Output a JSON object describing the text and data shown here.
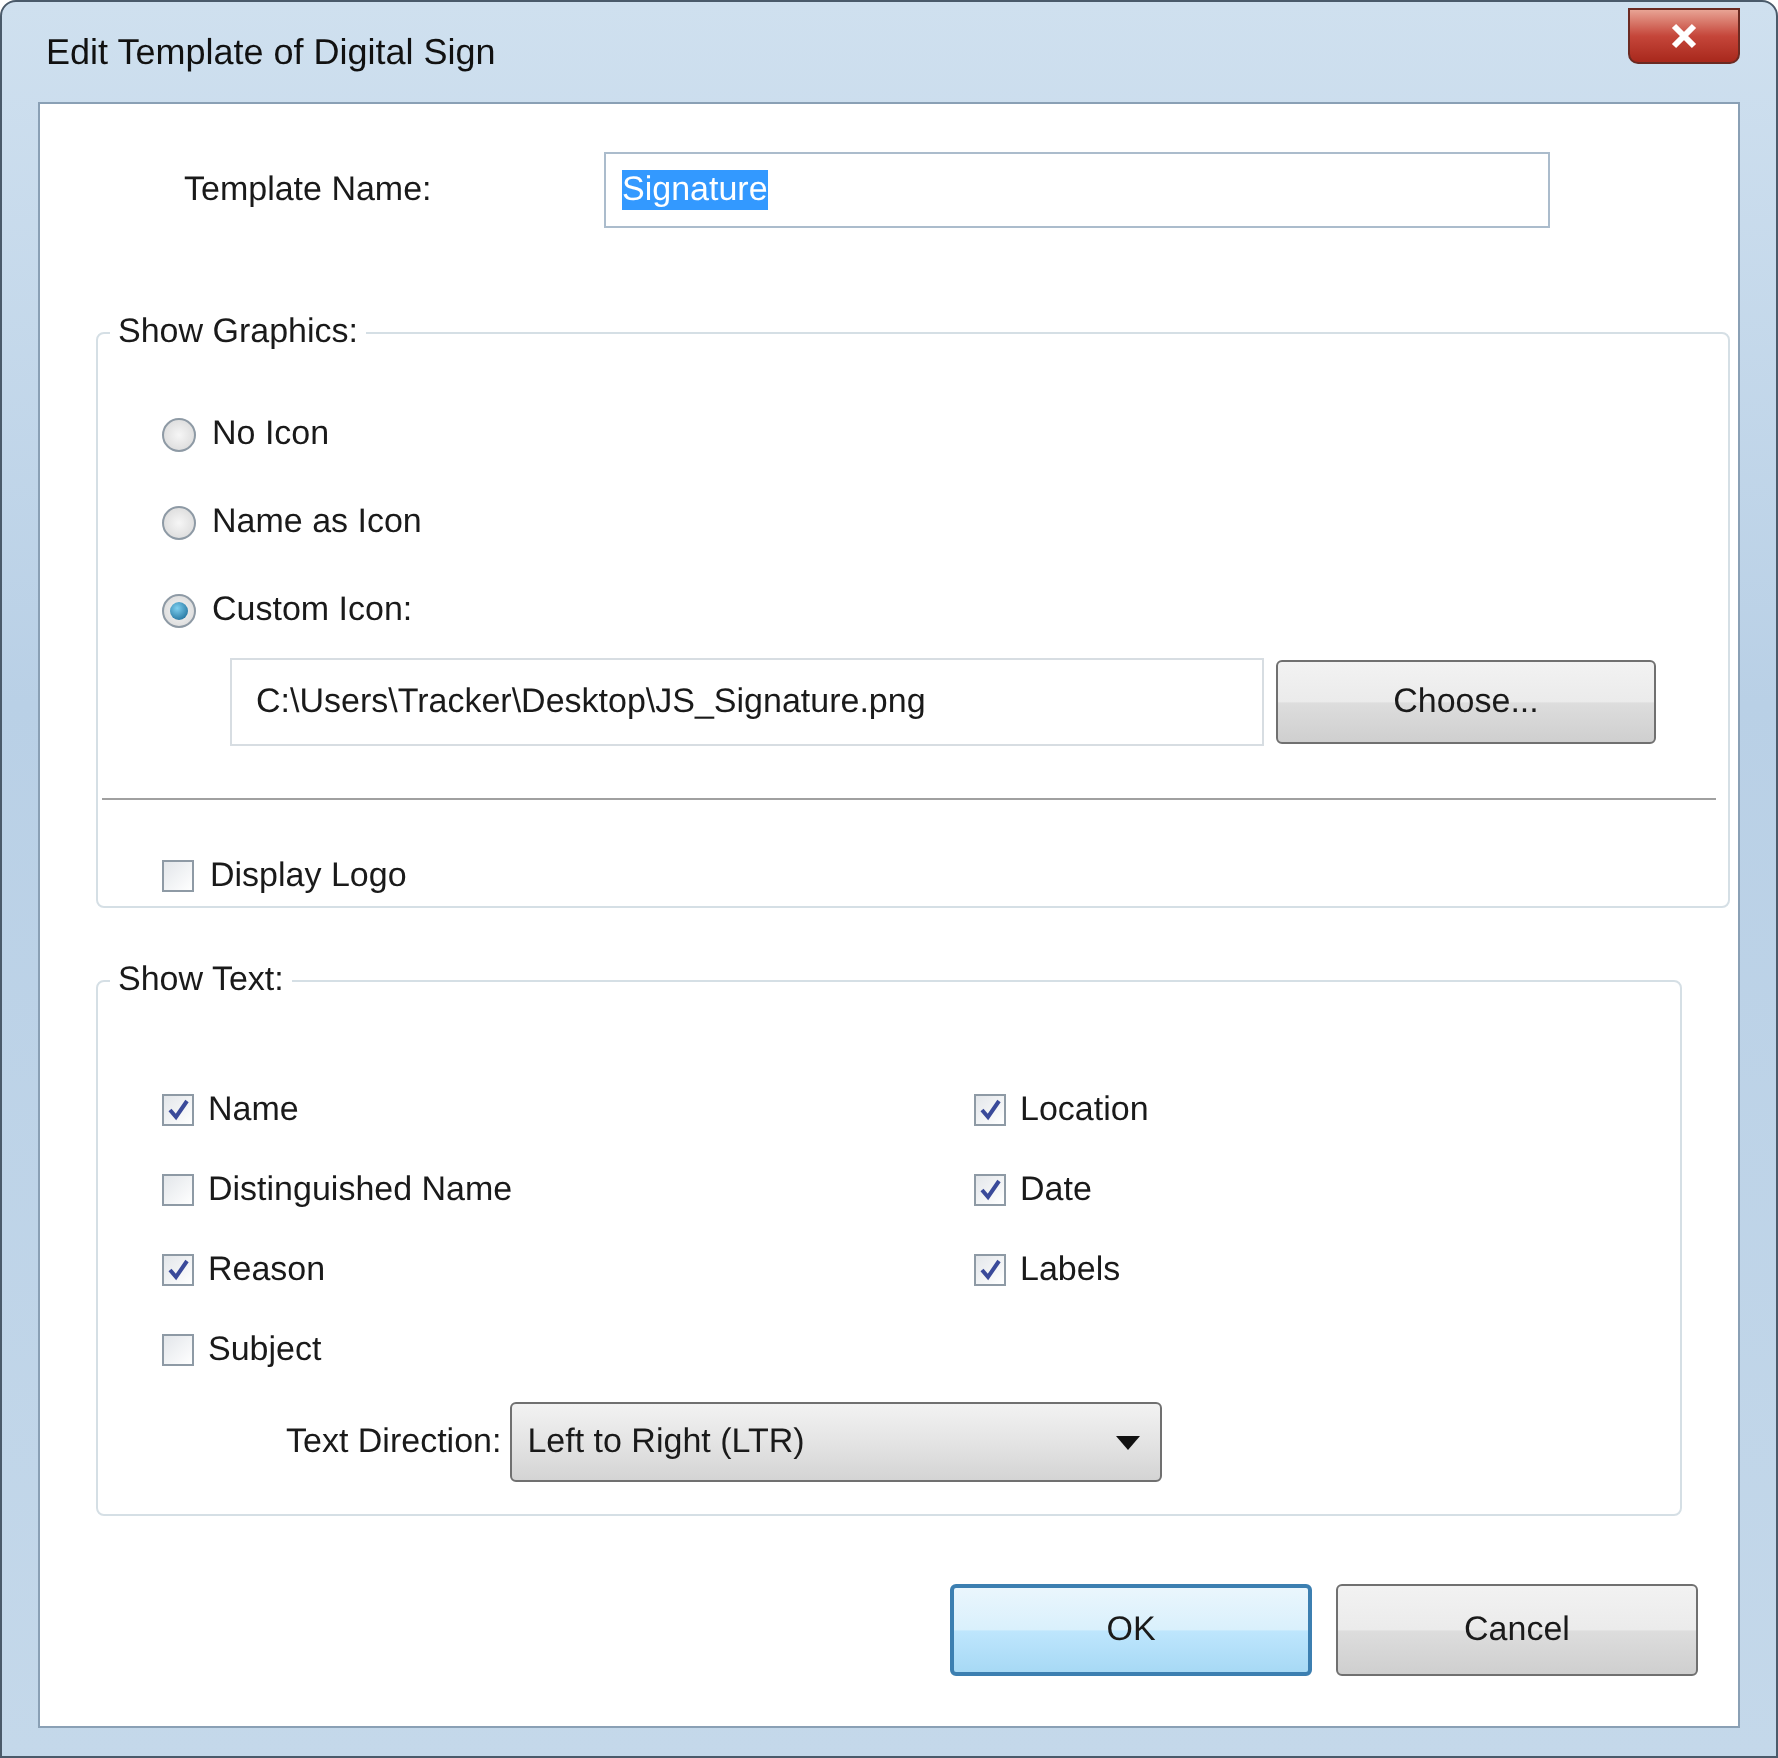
{
  "window": {
    "title": "Edit Template of Digital Sign"
  },
  "template_name": {
    "label": "Template Name:",
    "value": "Signature"
  },
  "show_graphics": {
    "title": "Show Graphics:",
    "options": [
      {
        "label": "No Icon",
        "selected": false
      },
      {
        "label": "Name as Icon",
        "selected": false
      },
      {
        "label": "Custom Icon:",
        "selected": true
      }
    ],
    "path": "C:\\Users\\Tracker\\Desktop\\JS_Signature.png",
    "choose": {
      "label": "Choose..."
    },
    "display_logo": {
      "label": "Display Logo",
      "checked": false
    }
  },
  "show_text": {
    "title": "Show Text:",
    "left": [
      {
        "label": "Name",
        "checked": true
      },
      {
        "label": "Distinguished Name",
        "checked": false
      },
      {
        "label": "Reason",
        "checked": true
      },
      {
        "label": "Subject",
        "checked": false
      }
    ],
    "right": [
      {
        "label": "Location",
        "checked": true
      },
      {
        "label": "Date",
        "checked": true
      },
      {
        "label": "Labels",
        "checked": true
      }
    ],
    "direction": {
      "label": "Text Direction:",
      "value": "Left to Right (LTR)"
    }
  },
  "buttons": [
    {
      "label": "OK",
      "default": true
    },
    {
      "label": "Cancel",
      "default": false
    }
  ]
}
